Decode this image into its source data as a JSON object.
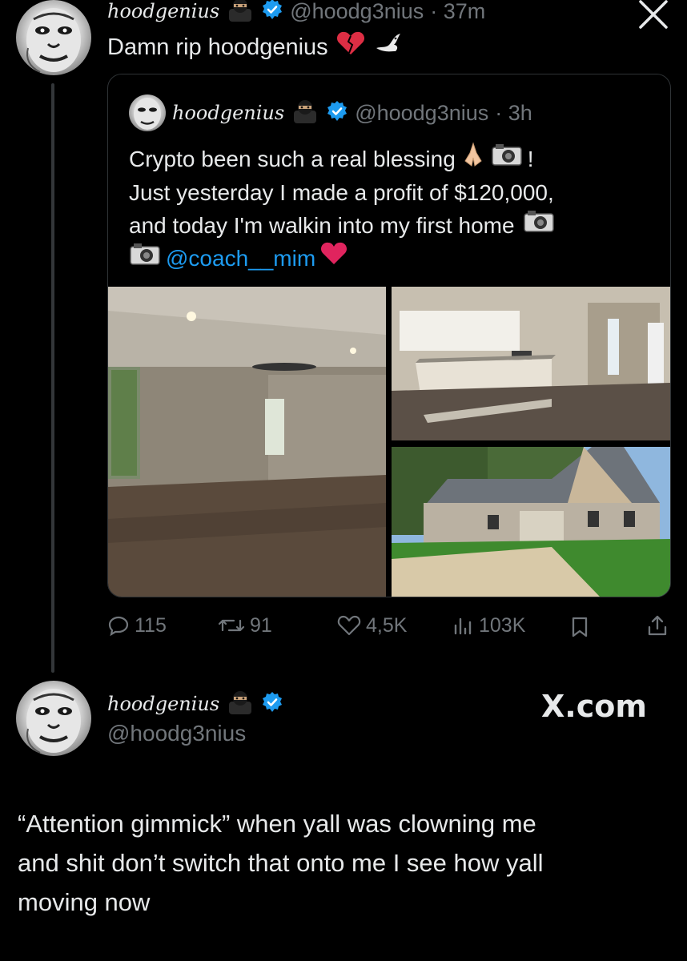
{
  "top_tweet": {
    "display_name": "hoodgenius",
    "handle": "@hoodg3nius",
    "time": "· 37m",
    "text": "Damn rip hoodgenius",
    "close_label": "X"
  },
  "quoted_tweet": {
    "display_name": "hoodgenius",
    "handle": "@hoodg3nius",
    "time": "· 3h",
    "line1": "Crypto been such a real blessing",
    "line1_end": "!",
    "line2": "Just yesterday I made a profit of $120,000,",
    "line3": "and today I'm walkin into my first home",
    "mention": "@coach__mim"
  },
  "actions": {
    "replies": "115",
    "reposts": "91",
    "likes": "4,5K",
    "views": "103K"
  },
  "bottom_tweet": {
    "display_name": "hoodgenius",
    "handle": "@hoodg3nius",
    "brand": "X.com",
    "text_line1": "“Attention gimmick” when yall was clowning me",
    "text_line2": "and shit don’t switch that onto me I see how yall",
    "text_line3": "moving now"
  },
  "colors": {
    "background": "#000000",
    "text": "#e7e9ea",
    "muted": "#71767b",
    "accent": "#1d9bf0",
    "heart_red": "#e0245e"
  }
}
